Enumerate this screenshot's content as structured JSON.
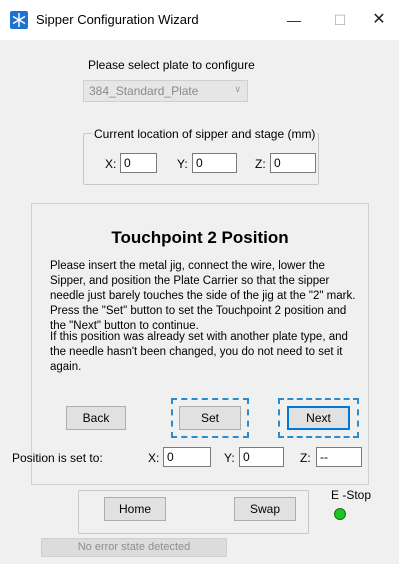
{
  "window": {
    "title": "Sipper Configuration Wizard",
    "minimize_glyph": "—",
    "maximize_glyph": "☐",
    "close_glyph": "✕",
    "icon": "snowflake-icon"
  },
  "plate": {
    "label": "Please select plate to configure",
    "selected": "384_Standard_Plate"
  },
  "current_location": {
    "legend": "Current location of sipper and stage (mm)",
    "x_label": "X:",
    "x_value": "0",
    "y_label": "Y:",
    "y_value": "0",
    "z_label": "Z:",
    "z_value": "0"
  },
  "touchpoint": {
    "title": "Touchpoint 2 Position",
    "instruction": "Please insert the metal jig, connect the wire, lower the Sipper, and position the Plate Carrier so that the sipper needle just barely touches the side of the jig at the \"2\" mark. Press the \"Set\" button to set the Touchpoint 2 position and the \"Next\" button to continue.",
    "note": "If this position was already set with another plate type, and the needle hasn't been changed, you do not need to set it again.",
    "back_label": "Back",
    "set_label": "Set",
    "next_label": "Next"
  },
  "position_set": {
    "label": "Position is set to:",
    "x_label": "X:",
    "x_value": "0",
    "y_label": "Y:",
    "y_value": "0",
    "z_label": "Z:",
    "z_value": "--"
  },
  "controls": {
    "home_label": "Home",
    "swap_label": "Swap",
    "estop_label": "E -Stop",
    "estop_color": "#1ec51e"
  },
  "status": {
    "text": "No error state detected"
  }
}
